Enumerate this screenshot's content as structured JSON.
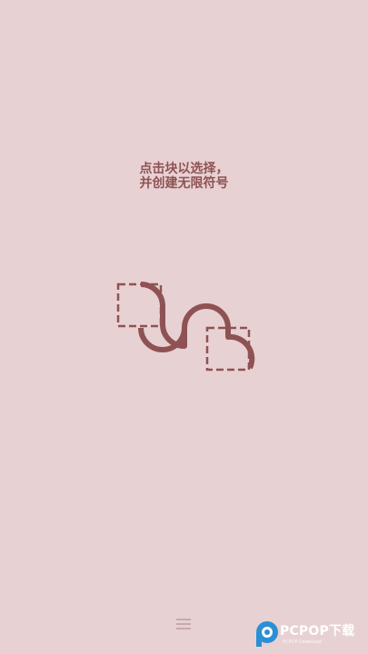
{
  "instruction": {
    "line1": "点击块以选择，",
    "line2": "并创建无限符号"
  },
  "icons": {
    "demo": "infinity-tile-demo-icon",
    "menu": "hamburger-menu-icon",
    "watermark": "pcpop-logo-icon"
  },
  "watermark": {
    "brand": "PCPOP下载",
    "sub": "PCPOP Download"
  },
  "colors": {
    "background": "#e8d1d2",
    "accent": "#8f5254",
    "menu": "#c8a9ab",
    "watermark_blue": "#2a8fd6"
  }
}
